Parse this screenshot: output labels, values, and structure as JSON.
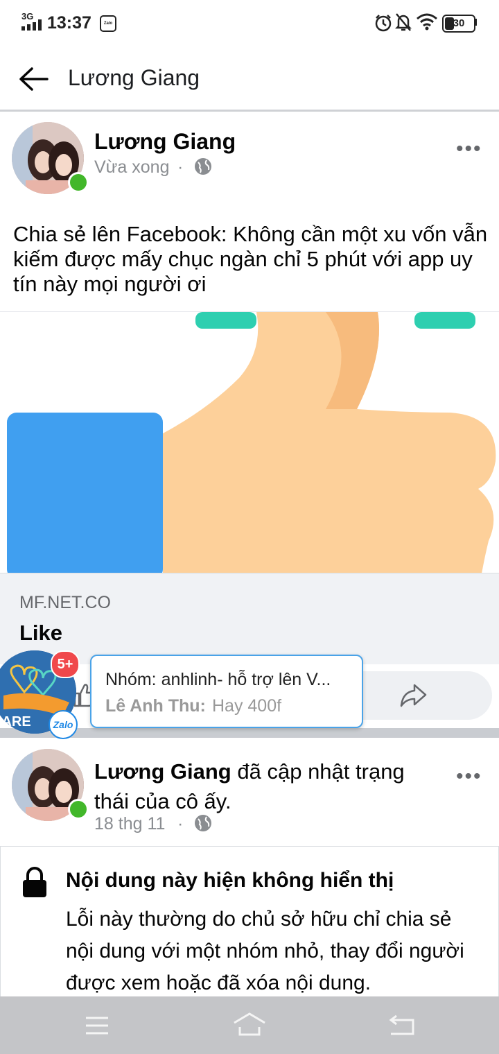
{
  "status_bar": {
    "network": "3G",
    "time": "13:37",
    "zalo_label": "Zalo",
    "battery": "30"
  },
  "app_bar": {
    "title": "Lương Giang"
  },
  "post1": {
    "author": "Lương Giang",
    "time": "Vừa xong",
    "separator": "·",
    "more": "•••",
    "text": "Chia sẻ lên Facebook: Không cần một xu vốn vẫn kiếm được mấy chục ngàn chỉ 5 phút với app uy tín này mọi người ơi",
    "link": {
      "domain": "MF.NET.CO",
      "title": "Like"
    }
  },
  "chat_head": {
    "badge": "5+",
    "label": "HARE",
    "zalo_label": "Zalo",
    "notif_title": "Nhóm: anhlinh- hỗ trợ lên V...",
    "notif_sender": "Lê Anh Thu:",
    "notif_message": "Hay 400f"
  },
  "post2": {
    "author": "Lương Giang",
    "action": "đã cập nhật trạng thái của cô ấy.",
    "time": "18 thg 11",
    "separator": "·",
    "more": "•••",
    "hidden_title": "Nội dung này hiện không hiển thị",
    "hidden_body": "Lỗi này thường do chủ sở hữu chỉ chia sẻ nội dung với một nhóm nhỏ, thay đổi người được xem hoặc đã xóa nội dung."
  },
  "colors": {
    "facebook_blue": "#1877f2",
    "online_green": "#42b72a",
    "thumb_skin": "#fdd09a",
    "cuff_blue": "#409ff0",
    "accent_teal": "#2ecfb0",
    "badge_red": "#f0484b"
  }
}
